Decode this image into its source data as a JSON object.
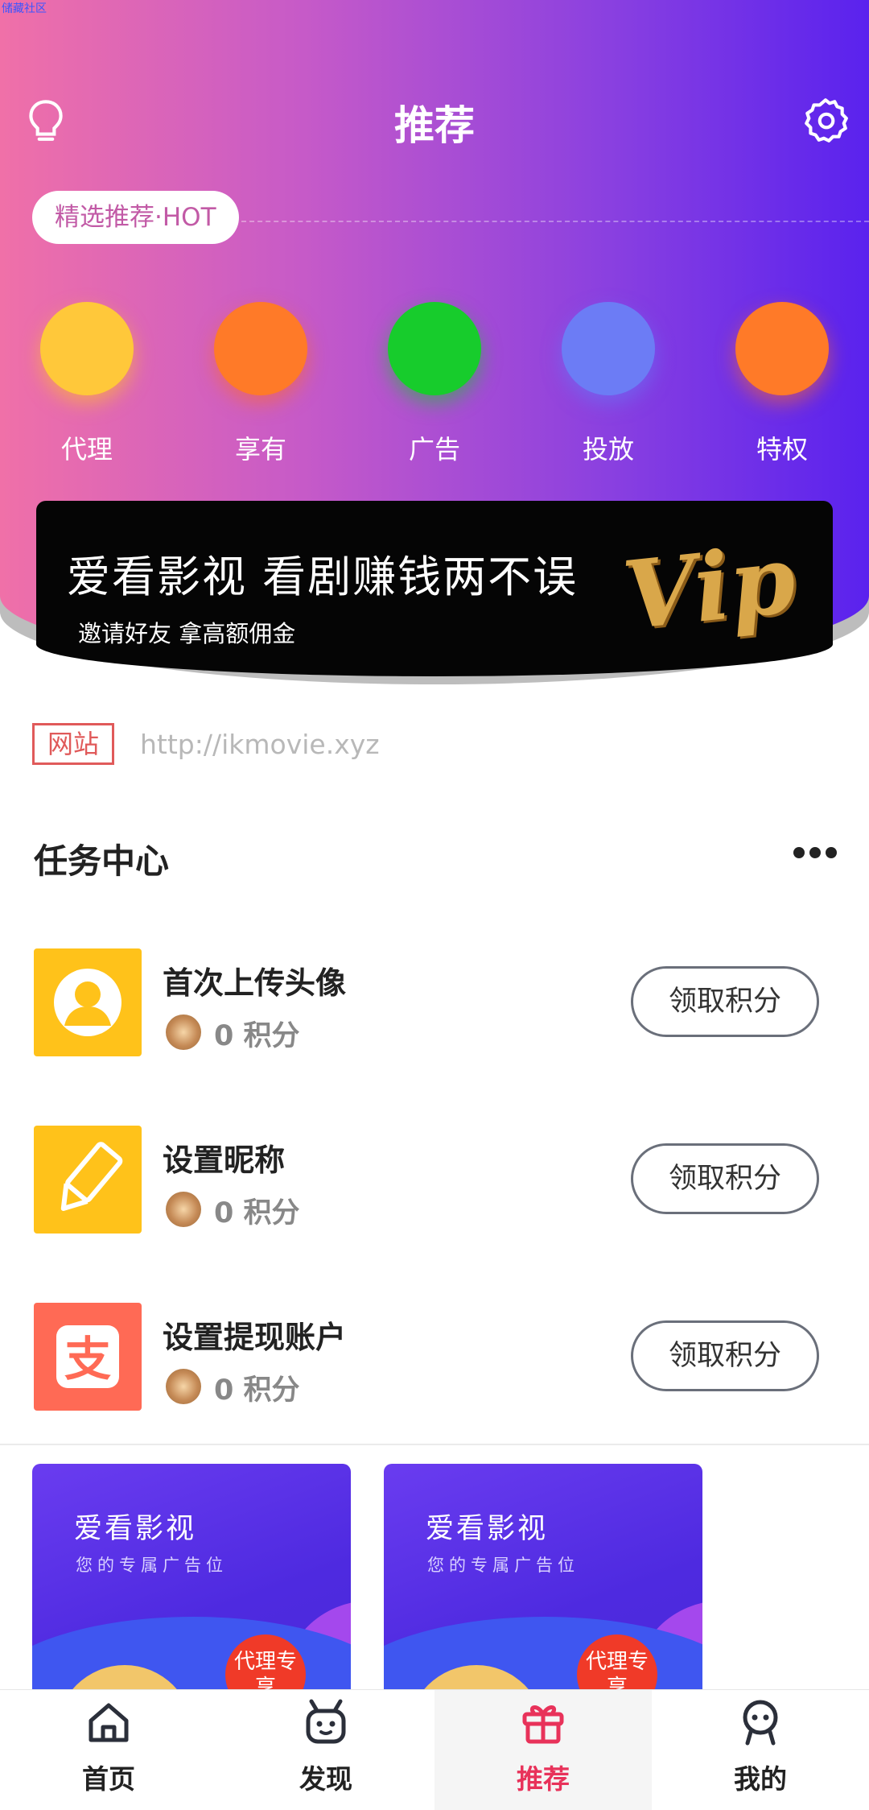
{
  "watermark": "储藏社区",
  "header": {
    "title": "推荐",
    "left_icon": "lightbulb-icon",
    "right_icon": "gear-icon"
  },
  "section_pill": "精选推荐·HOT",
  "categories": [
    {
      "label": "代理",
      "color": "#ffc83a"
    },
    {
      "label": "享有",
      "color": "#ff7a28"
    },
    {
      "label": "广告",
      "color": "#17cc2c"
    },
    {
      "label": "投放",
      "color": "#6c7cf5"
    },
    {
      "label": "特权",
      "color": "#ff7a28"
    }
  ],
  "banner": {
    "headline": "爱看影视  看剧赚钱两不误",
    "subline": "邀请好友  拿高额佣金",
    "badge": "Vip"
  },
  "website": {
    "tag": "网站",
    "url": "http://ikmovie.xyz"
  },
  "task_center": {
    "title": "任务中心",
    "tasks": [
      {
        "name": "首次上传头像",
        "points": "0 积分",
        "button": "领取积分",
        "icon": "avatar-icon",
        "icon_color": "#ffc21a"
      },
      {
        "name": "设置昵称",
        "points": "0 积分",
        "button": "领取积分",
        "icon": "pencil-icon",
        "icon_color": "#ffc21a"
      },
      {
        "name": "设置提现账户",
        "points": "0 积分",
        "button": "领取积分",
        "icon": "alipay-icon",
        "icon_color": "#ff6a55"
      }
    ]
  },
  "ads": [
    {
      "title": "爱看影视",
      "subtitle": "您的专属广告位",
      "badge": "代理专享"
    },
    {
      "title": "爱看影视",
      "subtitle": "您的专属广告位",
      "badge": "代理专享"
    }
  ],
  "tabbar": {
    "items": [
      {
        "label": "首页",
        "icon": "home-icon"
      },
      {
        "label": "发现",
        "icon": "robot-icon"
      },
      {
        "label": "推荐",
        "icon": "gift-icon",
        "active": true
      },
      {
        "label": "我的",
        "icon": "user-icon"
      }
    ],
    "active_color": "#e8325a"
  }
}
